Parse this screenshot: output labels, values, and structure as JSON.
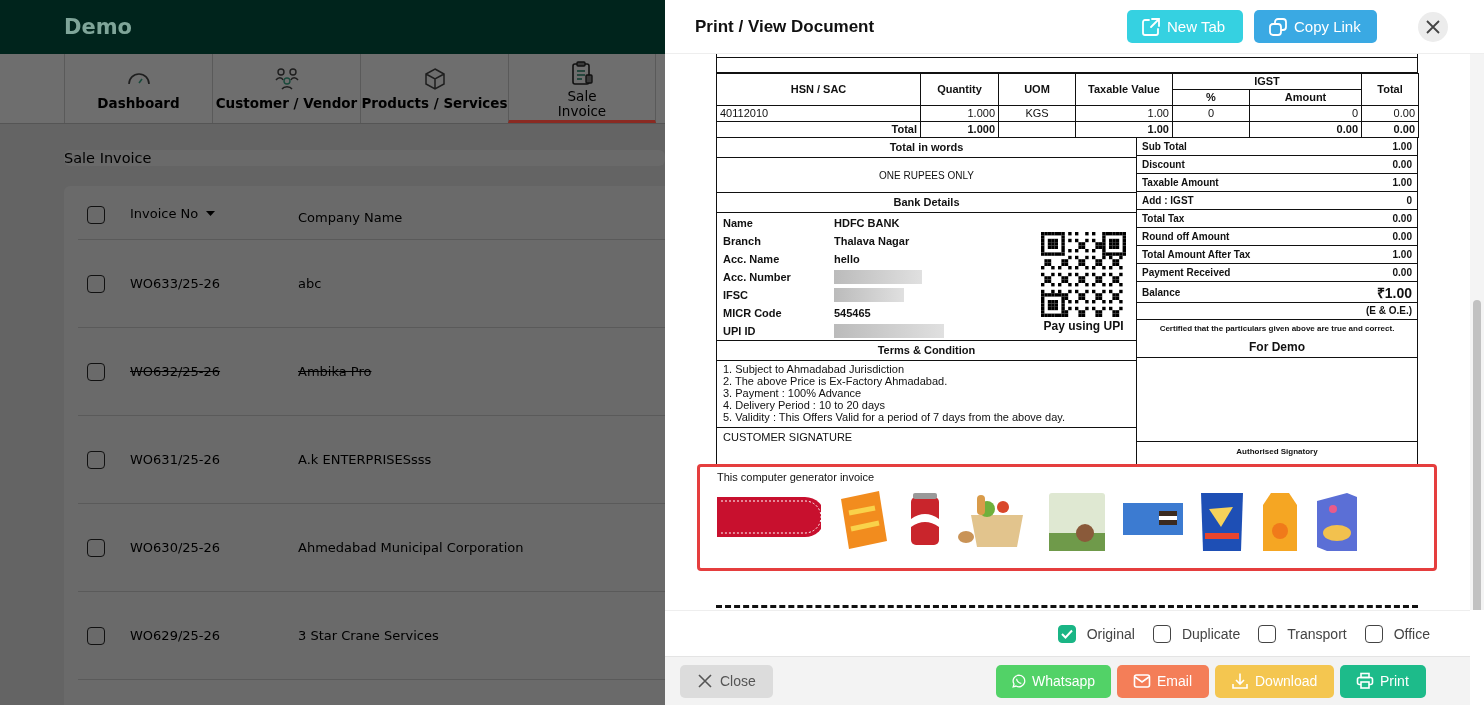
{
  "app": {
    "title": "Demo",
    "tabs": [
      {
        "label": "Dashboard",
        "selected": false
      },
      {
        "label": "Customer / Vendor",
        "selected": false
      },
      {
        "label": "Products / Services",
        "selected": false
      },
      {
        "label": "Sale Invoice",
        "selected": true
      }
    ],
    "page_title": "Sale Invoice",
    "table": {
      "select_all_checked": false,
      "columns": [
        {
          "label": "Invoice No",
          "sorted": true
        },
        {
          "label": "Company Name",
          "sorted": false
        }
      ],
      "rows": [
        {
          "invoice_no": "WO633/25-26",
          "company": "abc",
          "checked": false,
          "cancelled": false
        },
        {
          "invoice_no": "WO632/25-26",
          "company": "Ambika Pro",
          "checked": false,
          "cancelled": true
        },
        {
          "invoice_no": "WO631/25-26",
          "company": "A.k ENTERPRISESsss",
          "checked": false,
          "cancelled": false
        },
        {
          "invoice_no": "WO630/25-26",
          "company": "Ahmedabad Municipal Corporation",
          "checked": false,
          "cancelled": false
        },
        {
          "invoice_no": "WO629/25-26",
          "company": "3 Star Crane Services",
          "checked": false,
          "cancelled": false
        }
      ]
    }
  },
  "drawer": {
    "title": "Print / View Document",
    "actions": [
      {
        "label": "New Tab",
        "kind": "new_tab"
      },
      {
        "label": "Copy Link",
        "kind": "copy_link"
      }
    ],
    "document": {
      "items_table": {
        "columns": [
          "HSN / SAC",
          "Quantity",
          "UOM",
          "Taxable Value"
        ],
        "group": {
          "label": "IGST",
          "columns": [
            "%",
            "Amount"
          ]
        },
        "last_column": "Total",
        "rows": [
          [
            "40112010",
            "1.000",
            "KGS",
            "1.00",
            "0",
            "0",
            "0.00"
          ]
        ],
        "total_row": {
          "label": "Total",
          "cells": [
            "1.000",
            null,
            "1.00",
            null,
            "0.00",
            "0.00"
          ]
        }
      },
      "total_in_words": {
        "heading": "Total in words",
        "value": "ONE RUPEES ONLY"
      },
      "bank": {
        "heading": "Bank Details",
        "rows": [
          {
            "label": "Name",
            "value": "HDFC BANK",
            "redacted": false
          },
          {
            "label": "Branch",
            "value": "Thalava Nagar",
            "redacted": false
          },
          {
            "label": "Acc. Name",
            "value": "hello",
            "redacted": false
          },
          {
            "label": "Acc. Number",
            "redacted": true
          },
          {
            "label": "IFSC",
            "redacted": true
          },
          {
            "label": "MICR Code",
            "value": "545465",
            "redacted": false
          },
          {
            "label": "UPI ID",
            "redacted": true
          }
        ],
        "qr_caption": "Pay using UPI"
      },
      "terms": {
        "heading": "Terms & Condition",
        "lines": [
          "1. Subject to Ahmadabad Jurisdiction",
          "2. The above Price is Ex-Factory Ahmadabad.",
          "3. Payment : 100% Advance",
          "4. Delivery Period : 10 to 20 days",
          "5. Validity : This Offers Valid for a period of 7 days from the above day."
        ]
      },
      "customer_signature": "CUSTOMER SIGNATURE",
      "summary": [
        {
          "label": "Sub Total",
          "value": "1.00"
        },
        {
          "label": "Discount",
          "value": "0.00"
        },
        {
          "label": "Taxable Amount",
          "value": "1.00"
        },
        {
          "label": "Add : IGST",
          "value": "0"
        },
        {
          "label": "Total Tax",
          "value": "0.00"
        },
        {
          "label": "Round off Amount",
          "value": "0.00"
        },
        {
          "label": "Total Amount After Tax",
          "value": "1.00"
        },
        {
          "label": "Payment Received",
          "value": "0.00"
        }
      ],
      "balance": {
        "label": "Balance",
        "value": "₹1.00"
      },
      "eoe": "(E & O.E.)",
      "certified": "Certified that the particulars given above are true and correct.",
      "for_company": "For Demo",
      "authorised": "Authorised Signatory",
      "footer_note": "This computer generator invoice"
    },
    "copies": [
      {
        "label": "Original",
        "checked": true
      },
      {
        "label": "Duplicate",
        "checked": false
      },
      {
        "label": "Transport",
        "checked": false
      },
      {
        "label": "Office",
        "checked": false
      }
    ],
    "buttons": [
      {
        "label": "Close",
        "kind": "close"
      },
      {
        "label": "Whatsapp",
        "kind": "whatsapp"
      },
      {
        "label": "Email",
        "kind": "email"
      },
      {
        "label": "Download",
        "kind": "download"
      },
      {
        "label": "Print",
        "kind": "print"
      }
    ]
  }
}
